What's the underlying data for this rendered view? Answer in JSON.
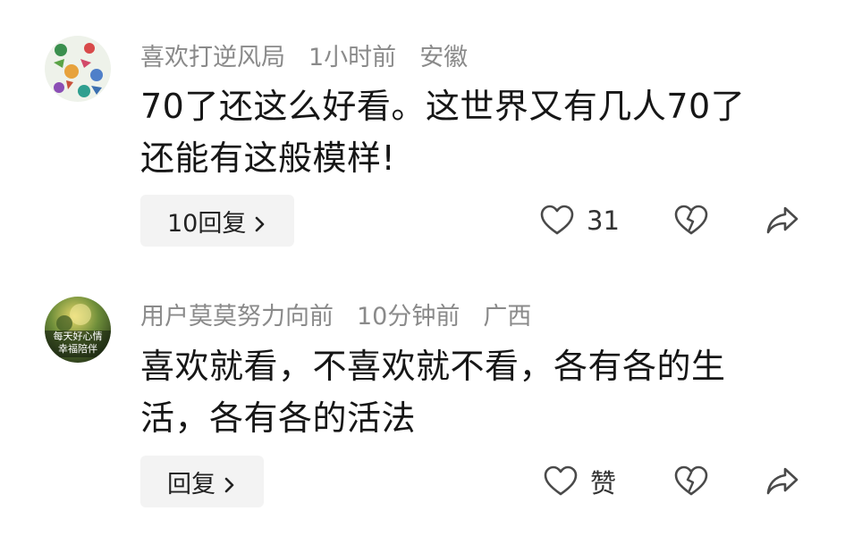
{
  "comments": [
    {
      "username": "喜欢打逆风局",
      "time": "1小时前",
      "location": "安徽",
      "text_lines": [
        "70了还这么好看。这世界又有几人70了",
        "还能有这般模样!"
      ],
      "reply_label": "10回复",
      "like_label": "31",
      "icons": [
        "heart-outline-icon",
        "broken-heart-icon",
        "share-icon"
      ]
    },
    {
      "username": "用户莫莫努力向前",
      "time": "10分钟前",
      "location": "广西",
      "text_lines": [
        "喜欢就看，不喜欢就不看，各有各的生",
        "活，各有各的活法"
      ],
      "reply_label": "回复",
      "like_label": "赞",
      "avatar_text": [
        "每天好心情",
        "幸福陪伴"
      ],
      "icons": [
        "heart-outline-icon",
        "broken-heart-icon",
        "share-icon"
      ]
    }
  ],
  "colors": {
    "username": "#8a8a8a",
    "text": "#161616",
    "reply_bg": "#f3f3f3",
    "icon": "#4a4a4a"
  }
}
